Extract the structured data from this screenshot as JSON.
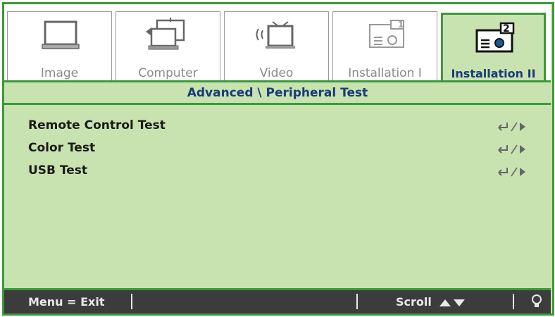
{
  "tabs": [
    {
      "label": "Image",
      "icon": "image-icon"
    },
    {
      "label": "Computer",
      "icon": "computer-icon"
    },
    {
      "label": "Video",
      "icon": "video-icon"
    },
    {
      "label": "Installation I",
      "icon": "projector-icon"
    },
    {
      "label": "Installation II",
      "icon": "projector-advanced-icon",
      "active": true
    }
  ],
  "breadcrumb": "Advanced \\ Peripheral Test",
  "menu": {
    "items": [
      {
        "label": "Remote Control Test",
        "action_icon": "enter-right-icon"
      },
      {
        "label": "Color Test",
        "action_icon": "enter-right-icon"
      },
      {
        "label": "USB Test",
        "action_icon": "enter-right-icon"
      }
    ]
  },
  "status": {
    "menu_exit": "Menu = Exit",
    "scroll": "Scroll",
    "bulb_icon": "lamp-icon"
  },
  "colors": {
    "accent_green": "#3a9a3a",
    "panel_green": "#c9e3b0",
    "title_blue": "#1a3a7a",
    "status_bg": "#3c3c3c"
  }
}
